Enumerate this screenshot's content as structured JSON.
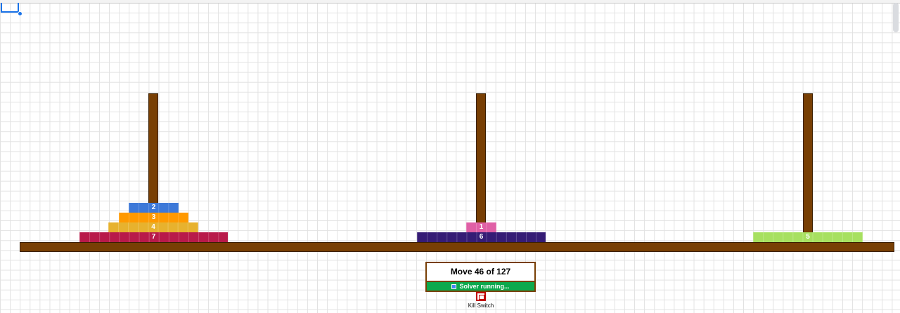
{
  "game": {
    "disks": [
      {
        "label": "7",
        "size": 7,
        "peg": "left",
        "level": 0,
        "color": "#b81a4a"
      },
      {
        "label": "4",
        "size": 4,
        "peg": "left",
        "level": 1,
        "color": "#e7b22e"
      },
      {
        "label": "3",
        "size": 3,
        "peg": "left",
        "level": 2,
        "color": "#ff9900"
      },
      {
        "label": "2",
        "size": 2,
        "peg": "left",
        "level": 3,
        "color": "#3c78d8"
      },
      {
        "label": "6",
        "size": 6,
        "peg": "center",
        "level": 0,
        "color": "#351c75"
      },
      {
        "label": "1",
        "size": 1,
        "peg": "center",
        "level": 1,
        "color": "#e060a6"
      },
      {
        "label": "5",
        "size": 5,
        "peg": "right",
        "level": 0,
        "color": "#a7e060"
      }
    ],
    "move_text": "Move 46 of 127",
    "current_move": 46,
    "total_moves": 127,
    "status_text": "Solver running...",
    "kill_switch_label": "Kill Switch",
    "kill_switch_checked": false
  },
  "colors": {
    "wood": "#783f04",
    "status_green": "#0ca94d",
    "kill_red": "#c00000",
    "selection_blue": "#1a73e8"
  },
  "icons": {
    "status": "refresh-icon",
    "kill_switch": "checkbox-icon"
  }
}
